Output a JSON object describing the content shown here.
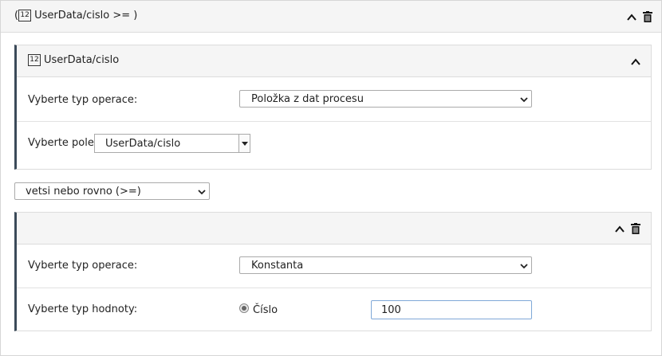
{
  "expression": {
    "open_paren": "(",
    "number_icon": "12",
    "title": "UserData/cislo >=  )"
  },
  "left_operand": {
    "number_icon": "12",
    "title": "UserData/cislo",
    "operation_label": "Vyberte typ operace:",
    "operation_value": "Položka z dat procesu",
    "field_label": "Vyberte pole:",
    "field_value": "UserData/cislo"
  },
  "operator": {
    "value": "vetsi nebo rovno (>=)"
  },
  "right_operand": {
    "operation_label": "Vyberte typ operace:",
    "operation_value": "Konstanta",
    "value_type_label": "Vyberte typ hodnoty:",
    "value_type_option": "Číslo",
    "value": "100"
  },
  "icons": [
    "chevron-up-icon",
    "trash-icon",
    "dropdown-arrow-icon",
    "number-type-icon"
  ]
}
